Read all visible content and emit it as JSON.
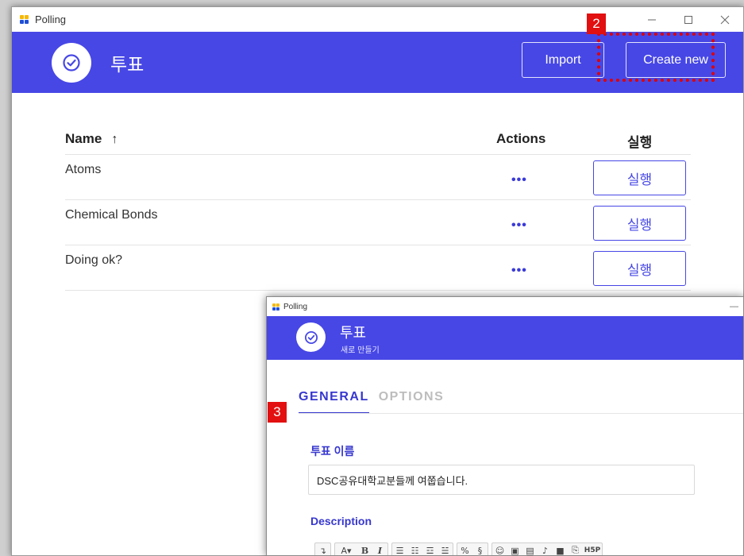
{
  "main_window": {
    "title": "Polling",
    "controls": [
      "minimize",
      "maximize",
      "close"
    ],
    "header": {
      "title": "투표",
      "import_label": "Import",
      "create_label": "Create new"
    },
    "table": {
      "columns": {
        "name": "Name",
        "sort_indicator": "↑",
        "actions": "Actions",
        "run": "실행"
      },
      "rows": [
        {
          "name": "Atoms",
          "actions": "•••",
          "run": "실행"
        },
        {
          "name": "Chemical Bonds",
          "actions": "•••",
          "run": "실행"
        },
        {
          "name": "Doing ok?",
          "actions": "•••",
          "run": "실행"
        }
      ]
    }
  },
  "annotations": {
    "badge_2": "2",
    "badge_3": "3",
    "highlight_color": "#e00000"
  },
  "second_window": {
    "title": "Polling",
    "minimize": "—",
    "header": {
      "title": "투표",
      "subtitle": "새로 만들기"
    },
    "tabs": [
      {
        "label": "GENERAL"
      },
      {
        "label": "OPTIONS"
      }
    ],
    "fields": {
      "name_label": "투표 이름",
      "name_value": "DSC공유대학교분들께 여쭙습니다.",
      "description_label": "Description"
    },
    "toolbar": [
      "paragraph",
      "font-size",
      "bold",
      "italic",
      "bulleted-list",
      "numbered-list",
      "outdent",
      "indent",
      "link",
      "unlink",
      "emoji",
      "image",
      "file",
      "audio",
      "video",
      "h5p-icon-1",
      "h5p"
    ]
  },
  "colors": {
    "accent": "#4747e6",
    "text": "#222222",
    "badge": "#e21010"
  }
}
